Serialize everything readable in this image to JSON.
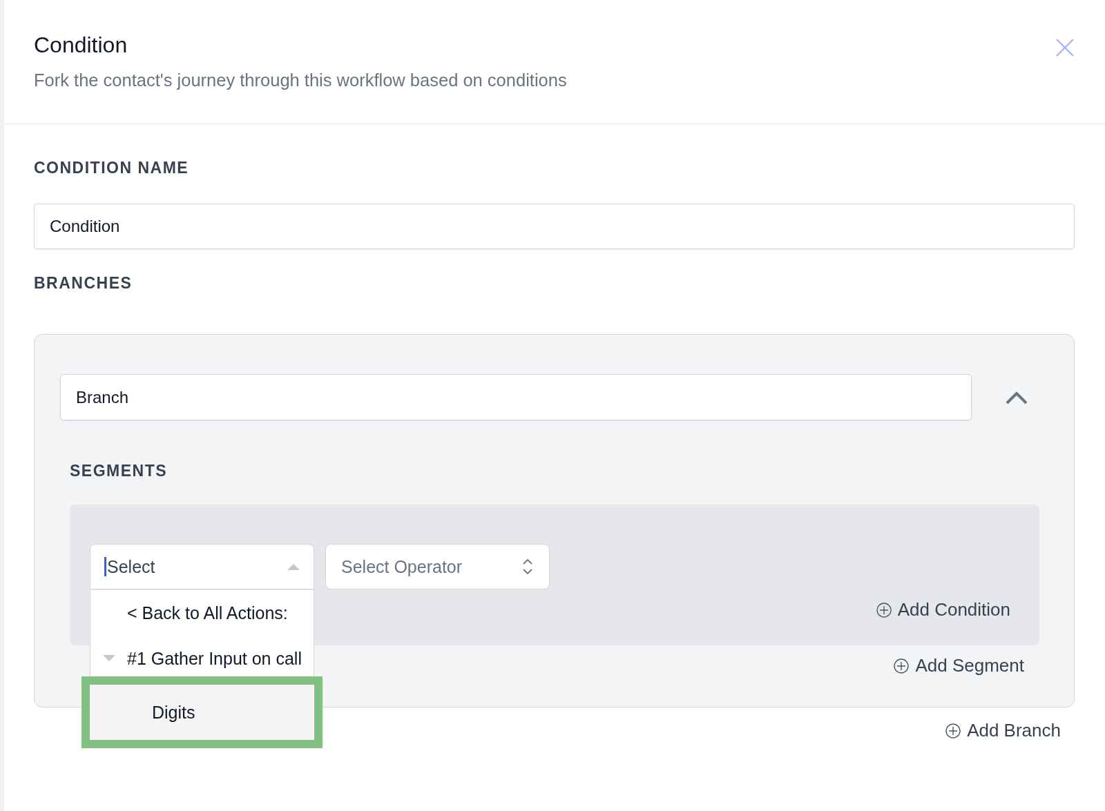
{
  "header": {
    "title": "Condition",
    "subtitle": "Fork the contact's journey through this workflow based on conditions"
  },
  "condition_name": {
    "label": "CONDITION NAME",
    "value": "Condition"
  },
  "branches": {
    "label": "BRANCHES",
    "items": [
      {
        "name": "Branch",
        "expanded": true,
        "segments_label": "SEGMENTS",
        "segments": [
          {
            "field": {
              "value": "Select",
              "open": true,
              "options": [
                {
                  "kind": "back",
                  "label": "< Back to All Actions:",
                  "highlighted": false
                },
                {
                  "kind": "group",
                  "label": "#1 Gather Input on call",
                  "expanded": true,
                  "highlighted": false
                },
                {
                  "kind": "option",
                  "label": "Digits",
                  "highlighted": true
                }
              ]
            },
            "operator": {
              "placeholder": "Select Operator"
            },
            "add_condition": "Add Condition"
          }
        ],
        "add_segment": "Add Segment"
      }
    ],
    "add_branch": "Add Branch"
  }
}
